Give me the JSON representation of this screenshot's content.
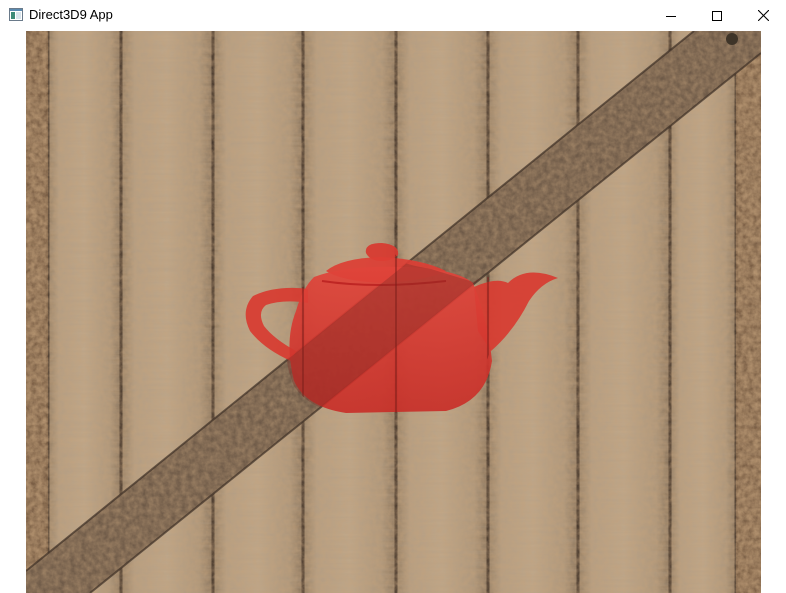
{
  "window": {
    "title": "Direct3D9 App",
    "controls": {
      "minimize": "minimize",
      "maximize": "maximize",
      "close": "close"
    }
  },
  "scene": {
    "background": "wooden-crate-texture",
    "object": "teapot",
    "colors": {
      "wood_light": "#b49a7c",
      "wood_mid": "#9b8264",
      "wood_dark": "#5a4634",
      "plank_line": "#3e3026",
      "metal_band": "#6e5a48",
      "rust": "#8a5a32",
      "teapot_red": "#d83a32"
    }
  }
}
